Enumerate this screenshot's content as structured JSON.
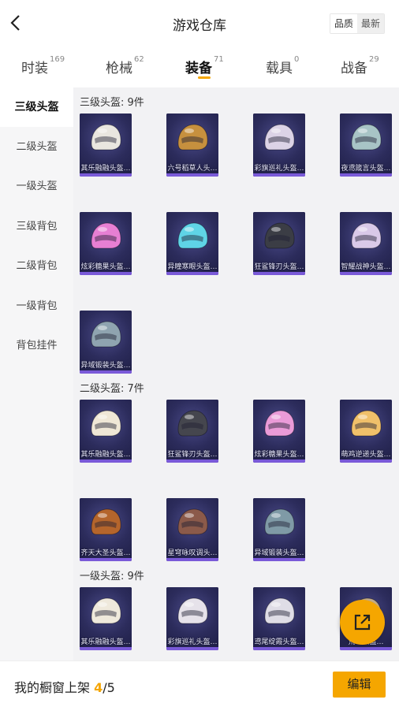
{
  "header": {
    "title": "游戏仓库",
    "sort_quality": "品质",
    "sort_latest": "最新"
  },
  "tabs": [
    {
      "label": "时装",
      "count": "169"
    },
    {
      "label": "枪械",
      "count": "62"
    },
    {
      "label": "装备",
      "count": "71"
    },
    {
      "label": "载具",
      "count": "0"
    },
    {
      "label": "战备",
      "count": "29"
    }
  ],
  "sidebar": {
    "items": [
      "三级头盔",
      "二级头盔",
      "一级头盔",
      "三级背包",
      "二级背包",
      "一级背包",
      "背包挂件"
    ]
  },
  "sections": [
    {
      "title": "三级头盔: 9件",
      "items": [
        {
          "name": "其乐融融头盔…",
          "icon": "white-helmet-icon",
          "color": "#e9e6df"
        },
        {
          "name": "六号稻草人头…",
          "icon": "scarecrow-helmet-icon",
          "color": "#c6903e"
        },
        {
          "name": "彩旗巡礼头盔…",
          "icon": "parade-helmet-icon",
          "color": "#dcd3e6"
        },
        {
          "name": "夜鸢箴言头盔…",
          "icon": "owl-helmet-icon",
          "color": "#a8c4c6"
        },
        {
          "name": "炫彩糖果头盔…",
          "icon": "candy-helmet-icon",
          "color": "#e77fd3"
        },
        {
          "name": "异瞳寒眼头盔…",
          "icon": "cyber-helmet-icon",
          "color": "#5fd4e6"
        },
        {
          "name": "狂鲨锋刃头盔…",
          "icon": "shark-helmet-icon",
          "color": "#3b3d45"
        },
        {
          "name": "智耀战神头盔…",
          "icon": "war-god-helmet-icon",
          "color": "#d9c9e8"
        },
        {
          "name": "异域锻装头盔…",
          "icon": "forged-helmet-icon",
          "color": "#8fa4b0"
        }
      ]
    },
    {
      "title": "二级头盔: 7件",
      "items": [
        {
          "name": "其乐融融头盔…",
          "icon": "white-helmet-icon",
          "color": "#efe7d6"
        },
        {
          "name": "狂鲨锋刃头盔…",
          "icon": "shark-helmet-icon",
          "color": "#45464e"
        },
        {
          "name": "炫彩糖果头盔…",
          "icon": "candy-helmet-icon",
          "color": "#ea9bd8"
        },
        {
          "name": "萌鸡逆递头盔…",
          "icon": "chick-helmet-icon",
          "color": "#f0c06a"
        },
        {
          "name": "齐天大圣头盔…",
          "icon": "monkey-king-helmet-icon",
          "color": "#b4652c"
        },
        {
          "name": "星穹咏叹调头…",
          "icon": "star-helmet-icon",
          "color": "#8b5a4a"
        },
        {
          "name": "异域锻装头盔…",
          "icon": "forged-helmet-icon",
          "color": "#7f9aa6"
        }
      ]
    },
    {
      "title": "一级头盔: 9件",
      "items": [
        {
          "name": "其乐融融头盔…",
          "icon": "white-helmet-icon",
          "color": "#efe9dc"
        },
        {
          "name": "彩旗巡礼头盔…",
          "icon": "parade-helmet-icon",
          "color": "#e6e2ea"
        },
        {
          "name": "鸢尾绽霞头盔…",
          "icon": "iris-helmet-icon",
          "color": "#dfdde6"
        },
        {
          "name": "荒…头盔…",
          "icon": "desert-helmet-icon",
          "color": "#c9b08a"
        }
      ]
    }
  ],
  "bottom": {
    "label_prefix": "我的橱窗上架 ",
    "current": "4",
    "total": "/5",
    "edit": "编辑"
  },
  "colors": {
    "accent": "#f5a600",
    "card_bg": "#2c2c5c",
    "card_bar": "#7a5ad8"
  }
}
